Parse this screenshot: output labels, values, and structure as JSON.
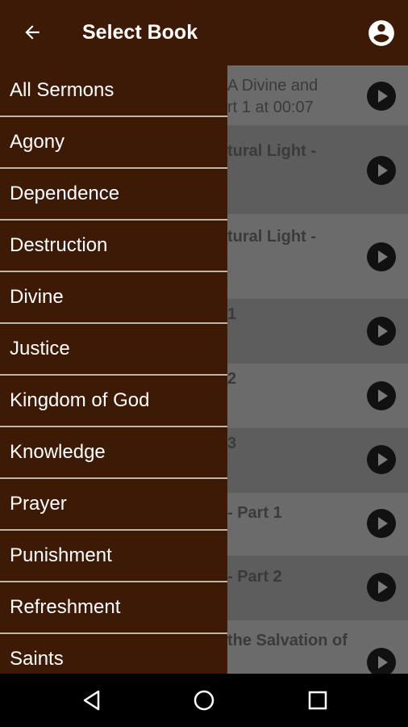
{
  "appbar": {
    "title": "Select Book"
  },
  "background_list": [
    {
      "line1": "A Divine and",
      "line2": "rt 1 at 00:07",
      "bold": false
    },
    {
      "line1": "tural Light -",
      "line2": "",
      "bold": true
    },
    {
      "line1": "tural Light -",
      "line2": "",
      "bold": true
    },
    {
      "line1": "1",
      "line2": "",
      "bold": true
    },
    {
      "line1": "2",
      "line2": "",
      "bold": true
    },
    {
      "line1": "3",
      "line2": "",
      "bold": true
    },
    {
      "line1": "- Part 1",
      "line2": "",
      "bold": true
    },
    {
      "line1": "- Part 2",
      "line2": "",
      "bold": true
    },
    {
      "line1": "the Salvation of",
      "line2": "",
      "bold": true
    }
  ],
  "drawer": {
    "items": [
      "All Sermons",
      "Agony",
      "Dependence",
      "Destruction",
      "Divine",
      "Justice",
      "Kingdom of God",
      "Knowledge",
      "Prayer",
      "Punishment",
      "Refreshment",
      "Saints"
    ]
  },
  "colors": {
    "brand": "#3d1a05",
    "divider": "#bfb3aa",
    "scrim": "#6b6b6b"
  },
  "icons": {
    "back": "arrow-left-icon",
    "account": "account-circle-icon",
    "nav_back": "triangle-back-icon",
    "nav_home": "circle-home-icon",
    "nav_recents": "square-recents-icon",
    "play": "play-circle-icon"
  }
}
